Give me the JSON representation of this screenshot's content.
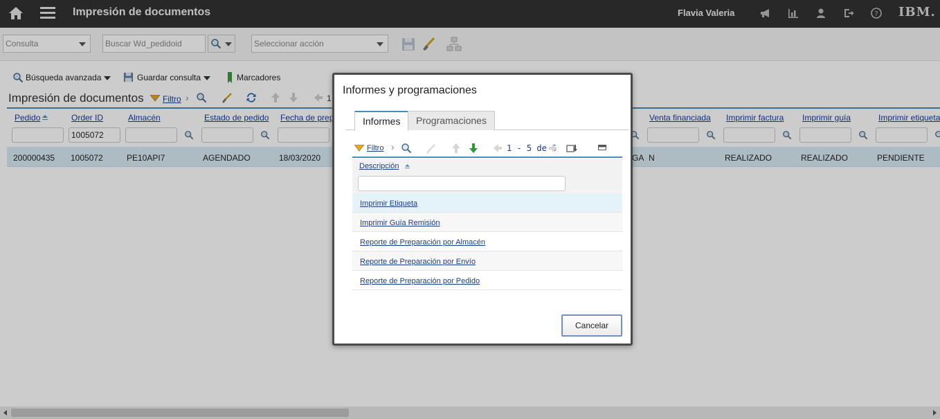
{
  "topbar": {
    "app_title": "Impresión de documentos",
    "user_name": "Flavia Valeria",
    "brand": "IBM."
  },
  "toolbar": {
    "query_select_value": "Consulta",
    "search_placeholder": "Buscar Wd_pedidoid",
    "action_select_value": "Seleccionar acción"
  },
  "secondary": {
    "advanced_search": "Búsqueda avanzada",
    "save_query": "Guardar consulta",
    "bookmarks": "Marcadores",
    "page_title": "Impresión de documentos",
    "filter": "Filtro",
    "page_partial": "1"
  },
  "table": {
    "columns": [
      "Pedido",
      "Order ID",
      "Almacén",
      "Estado de pedido",
      "Fecha de prep.",
      "Venta financiada",
      "Imprimir factura",
      "Imprimir guía",
      "Imprimir etiqueta"
    ],
    "filter_order_id": "1005072",
    "row": {
      "pedido": "200000435",
      "order_id": "1005072",
      "almacen": "PE10API7",
      "estado": "AGENDADO",
      "fecha": "18/03/2020",
      "partial_cell": "GA",
      "venta_financiada": "N",
      "imprimir_factura": "REALIZADO",
      "imprimir_guia": "REALIZADO",
      "imprimir_etiqueta": "PENDIENTE"
    }
  },
  "modal": {
    "title": "Informes y programaciones",
    "tabs": [
      "Informes",
      "Programaciones"
    ],
    "filter": "Filtro",
    "pagination": "1 - 5 de 5",
    "column_header": "Descripción",
    "rows": [
      "Imprimir Etiqueta",
      "Imprimir Guía Remisión",
      "Reporte de Preparación por Almacén",
      "Reporte de Preparación por Envío",
      "Reporte de Preparación por Pedido"
    ],
    "cancel_label": "Cancelar"
  },
  "colors": {
    "topbar_bg": "#323232",
    "accent_blue": "#4a8db3",
    "link_blue": "#1a3d8f",
    "selected_row": "#d8ebf3"
  }
}
